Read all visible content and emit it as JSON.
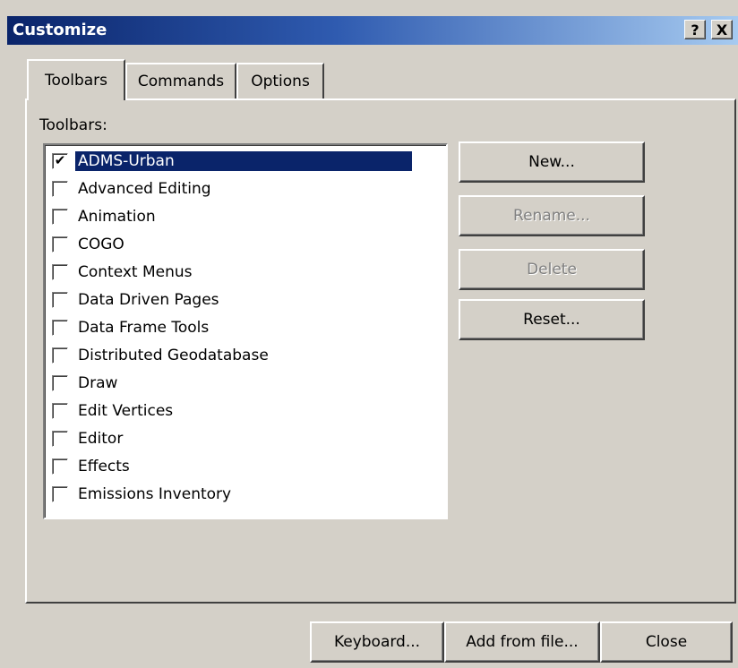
{
  "window": {
    "title": "Customize",
    "help_button": "?",
    "close_button": "X"
  },
  "tabs": [
    {
      "label": "Toolbars",
      "active": true
    },
    {
      "label": "Commands",
      "active": false
    },
    {
      "label": "Options",
      "active": false
    }
  ],
  "toolbars_label": "Toolbars:",
  "toolbars_list": [
    {
      "label": "ADMS-Urban",
      "checked": true,
      "selected": true
    },
    {
      "label": "Advanced Editing",
      "checked": false
    },
    {
      "label": "Animation",
      "checked": false
    },
    {
      "label": "COGO",
      "checked": false
    },
    {
      "label": "Context Menus",
      "checked": false
    },
    {
      "label": "Data Driven Pages",
      "checked": false
    },
    {
      "label": "Data Frame Tools",
      "checked": false
    },
    {
      "label": "Distributed Geodatabase",
      "checked": false
    },
    {
      "label": "Draw",
      "checked": false
    },
    {
      "label": "Edit Vertices",
      "checked": false
    },
    {
      "label": "Editor",
      "checked": false
    },
    {
      "label": "Effects",
      "checked": false
    },
    {
      "label": "Emissions Inventory",
      "checked": false
    }
  ],
  "check_mark": "✔",
  "scroll_up_glyph": "▲",
  "scroll_down_glyph": "▼",
  "side_buttons": {
    "new_label": "New...",
    "rename_label": "Rename...",
    "delete_label": "Delete",
    "reset_label": "Reset..."
  },
  "bottom_buttons": {
    "keyboard_label": "Keyboard...",
    "add_from_file_label": "Add from file...",
    "close_label": "Close"
  },
  "colors": {
    "dialog_face": "#d4d0c8",
    "title_start": "#0a246a",
    "title_end": "#a6caf0",
    "selection": "#0a246a"
  }
}
